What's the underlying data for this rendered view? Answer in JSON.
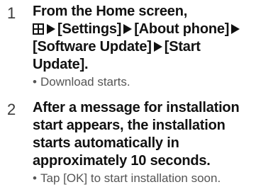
{
  "steps": [
    {
      "number": "1",
      "line1": "From the Home screen,",
      "path": [
        "[Settings]",
        "[About phone]",
        "[Software Update]",
        "[Start Update]."
      ],
      "note": "Download starts."
    },
    {
      "number": "2",
      "title": "After a message for installation start appears, the installation starts automatically in approximately 10 seconds.",
      "note": "Tap [OK] to start installation soon."
    }
  ],
  "icons": {
    "apps": "apps-grid-icon",
    "separator": "right-triangle-icon"
  },
  "colors": {
    "text_title": "#111111",
    "text_note": "#555555",
    "step_number": "#3a3a3a"
  }
}
